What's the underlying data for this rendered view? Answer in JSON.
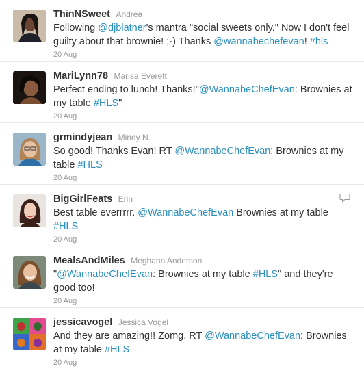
{
  "tweets": [
    {
      "screen_name": "ThinNSweet",
      "full_name": "Andrea",
      "parts": [
        "Following ",
        "@djblatner",
        "'s mantra \"social sweets only.\" Now I don't feel guilty about that brownie! ;-) Thanks ",
        "@wannabechefevan",
        "! ",
        "#hls"
      ],
      "time": "20 Aug"
    },
    {
      "screen_name": "MariLynn78",
      "full_name": "Marisa Everett",
      "parts": [
        "Perfect ending to lunch! Thanks!\"",
        "@WannabeChefEvan",
        ": Brownies at my table ",
        "#HLS",
        "\""
      ],
      "time": "20 Aug"
    },
    {
      "screen_name": "grmindyjean",
      "full_name": "Mindy N.",
      "parts": [
        "So good! Thanks Evan! RT ",
        "@WannabeChefEvan",
        ": Brownies at my table ",
        "#HLS"
      ],
      "time": "20 Aug"
    },
    {
      "screen_name": "BigGirlFeats",
      "full_name": "Erin",
      "parts": [
        "Best table everrrrr. ",
        "@WannabeChefEvan",
        " Brownies at my table ",
        "#HLS"
      ],
      "time": "20 Aug",
      "has_reply_icon": true
    },
    {
      "screen_name": "MealsAndMiles",
      "full_name": "Meghann Anderson",
      "parts": [
        "\"",
        "@WannabeChefEvan",
        ": Brownies at my table ",
        "#HLS",
        "\" and they're good too!"
      ],
      "time": "20 Aug"
    },
    {
      "screen_name": "jessicavogel",
      "full_name": "Jessica Vogel",
      "parts": [
        "And they are amazing!! Zomg. RT ",
        "@WannabeChefEvan",
        ": Brownies at my table ",
        "#HLS"
      ],
      "time": "20 Aug"
    }
  ],
  "icons": {
    "reply": "speech-bubble-icon",
    "avatar": "profile-photo"
  },
  "colors": {
    "link": "#2a8fbd",
    "text": "#333333",
    "muted": "#999999"
  }
}
